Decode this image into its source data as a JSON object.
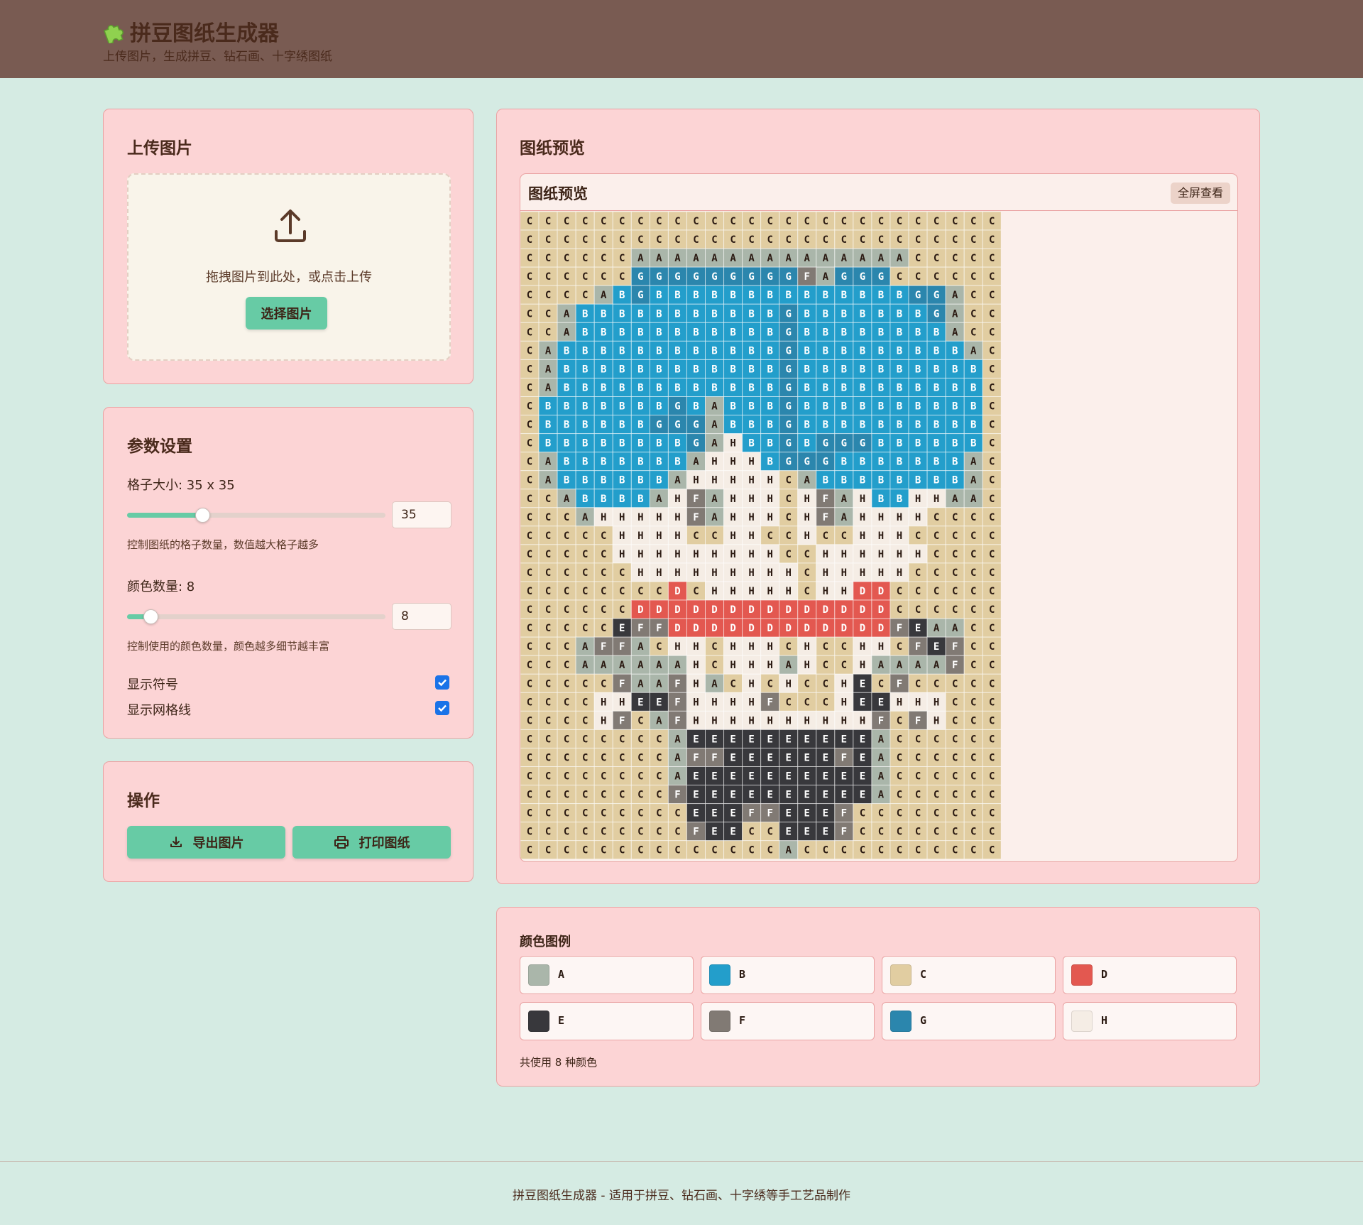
{
  "header": {
    "title": "拼豆图纸生成器",
    "subtitle": "上传图片，生成拼豆、钻石画、十字绣图纸",
    "icon": "puzzle-piece-icon"
  },
  "upload": {
    "title": "上传图片",
    "icon": "upload-icon",
    "hint": "拖拽图片到此处，或点击上传",
    "button_label": "选择图片"
  },
  "params": {
    "title": "参数设置",
    "grid_size_label": "格子大小: 35 x 35",
    "grid_size_value": "35",
    "grid_size_ratio": 0.29,
    "grid_size_help": "控制图纸的格子数量，数值越大格子越多",
    "color_count_label": "颜色数量: 8",
    "color_count_value": "8",
    "color_count_ratio": 0.09,
    "color_count_help": "控制使用的颜色数量，颜色越多细节越丰富",
    "show_symbols_label": "显示符号",
    "show_symbols_checked": true,
    "show_grid_label": "显示网格线",
    "show_grid_checked": true
  },
  "actions": {
    "title": "操作",
    "export_label": "导出图片",
    "export_icon": "download-icon",
    "print_label": "打印图纸",
    "print_icon": "printer-icon"
  },
  "preview": {
    "section_title": "图纸预览",
    "panel_title": "图纸预览",
    "fullscreen_label": "全屏查看",
    "rows": [
      "CCCCCCCCCCCCCCCCCCCCCCCCCC",
      "CCCCCCCCCCCCCCCCCCCCCCCCCC",
      "CCCCCCAAAAAAAAAAAAAAACCCCC",
      "CCCCCCGGGGGGGGGFAGGGCCCCCC",
      "CCCCABGBBBBBBBBBBBBBBGGACC",
      "CCABBBBBBBBBBBGBBBBBBBGACC",
      "CCABBBBBBBBBBBGBBBBBBBBACC",
      "CABBBBBBBBBBBBGBBBBBBBBBAC",
      "CABBBBBBBBBBBBGBBBBBBBBBBC",
      "CABBBBBBBBBBBBGBBBBBBBBBBC",
      "CBBBBBBBGBABBBGBBBBBBBBBBC",
      "CBBBBBBGGGABBBGBBBBBBBBBBC",
      "CBBBBBBBBGAHBBGBGGGBBBBBBC",
      "CABBBBBBBAHHHBGGGBBBBBBBAC",
      "CABBBBBBAHHHHHCABBBBBBBBAC",
      "CCABBBBAHFAHHHCHFAHBBHHAAC",
      "CCCAHHHHHFAHHHCHFAHHHHCCCC",
      "CCCCCHHHHCCHHCCHCCHHHCCCCC",
      "CCCCCHHHHHHHHHCCHHHHHHCCCC",
      "CCCCCCHHHHHHHHHCHHHHHCCCCC",
      "CCCCCCCCDCHHHHHCHHDDCCCCCC",
      "CCCCCCDDDDDDDDDDDDDDCCCCCC",
      "CCCCCEFFDDDDDDDDDDDDFEAACC",
      "CCCAFFACHHCHHHCHCCHHCFEFCC",
      "CCCAAAAAAHCHHHAHCCHAAAAFCC",
      "CCCCCFAAFHACHCHCCHECFCCCCC",
      "CCCCHHEEFHHHHFCCCHEEHHHCCC",
      "CCCCHFCAFHHHHHHHHHHFCFHCCC",
      "CCCCCCCCAEEEEEEEEEEACCCCCC",
      "CCCCCCCCAFFEEEEEEFEACCCCCC",
      "CCCCCCCCAEEEEEEEEEEACCCCCC",
      "CCCCCCCCFEEEEEEEEEEACCCCCC",
      "CCCCCCCCCEEEFFEEEFCCCCCCCC",
      "CCCCCCCCCFEECCEEEFCCCCCCCC",
      "CCCCCCCCCCCCCCACCCCCCCCCCC"
    ]
  },
  "legend": {
    "title": "颜色图例",
    "items": [
      {
        "code": "A",
        "color": "#aab6aa"
      },
      {
        "code": "B",
        "color": "#239ecb"
      },
      {
        "code": "C",
        "color": "#e1cda1"
      },
      {
        "code": "D",
        "color": "#e35850"
      },
      {
        "code": "E",
        "color": "#38383c"
      },
      {
        "code": "F",
        "color": "#817a74"
      },
      {
        "code": "G",
        "color": "#2b86ad"
      },
      {
        "code": "H",
        "color": "#f5ede5"
      }
    ],
    "count_text": "共使用 8 种颜色"
  },
  "footer": {
    "text": "拼豆图纸生成器 - 适用于拼豆、钻石画、十字绣等手工艺品制作"
  }
}
